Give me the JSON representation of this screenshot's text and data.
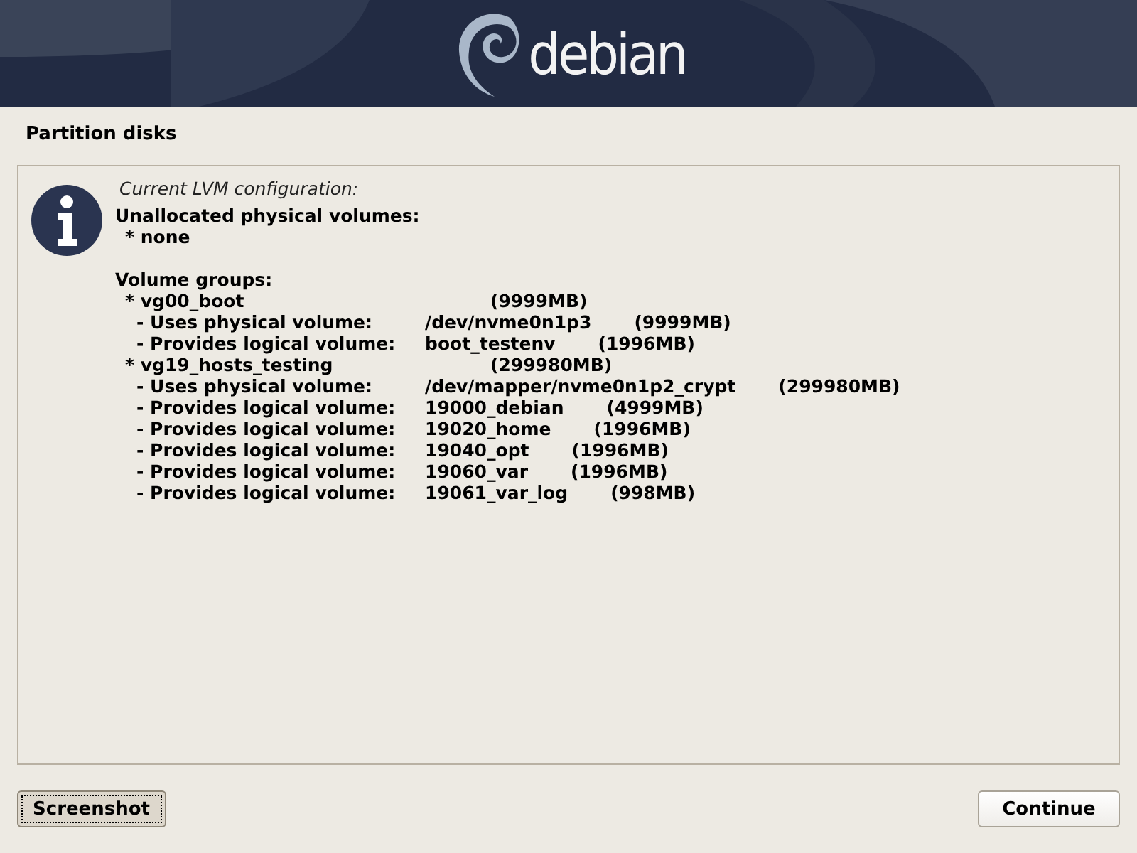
{
  "banner": {
    "logo_text": "debian"
  },
  "page_title": "Partition disks",
  "message": {
    "caption": "Current LVM configuration:",
    "lines": [
      {
        "kind": "heading",
        "text": "Unallocated physical volumes:"
      },
      {
        "kind": "item",
        "text": "* none"
      },
      {
        "kind": "blank"
      },
      {
        "kind": "heading",
        "text": "Volume groups:"
      },
      {
        "kind": "group",
        "text": "* vg00_boot",
        "size": "(9999MB)"
      },
      {
        "kind": "detail",
        "text": "- Uses physical volume:",
        "value": "/dev/nvme0n1p3",
        "size": "(9999MB)"
      },
      {
        "kind": "detail",
        "text": "- Provides logical volume:",
        "value": "boot_testenv",
        "size": "(1996MB)"
      },
      {
        "kind": "group",
        "text": "* vg19_hosts_testing",
        "size": "(299980MB)"
      },
      {
        "kind": "detail",
        "text": "- Uses physical volume:",
        "value": "/dev/mapper/nvme0n1p2_crypt",
        "size": "(299980MB)"
      },
      {
        "kind": "detail",
        "text": "- Provides logical volume:",
        "value": "19000_debian",
        "size": "(4999MB)"
      },
      {
        "kind": "detail",
        "text": "- Provides logical volume:",
        "value": "19020_home",
        "size": "(1996MB)"
      },
      {
        "kind": "detail",
        "text": "- Provides logical volume:",
        "value": "19040_opt",
        "size": "(1996MB)"
      },
      {
        "kind": "detail",
        "text": "- Provides logical volume:",
        "value": "19060_var",
        "size": "(1996MB)"
      },
      {
        "kind": "detail",
        "text": "- Provides logical volume:",
        "value": "19061_var_log",
        "size": "(998MB)"
      }
    ]
  },
  "buttons": [
    {
      "label": "Screenshot",
      "selected": true
    },
    {
      "label": "Continue",
      "selected": false
    }
  ]
}
